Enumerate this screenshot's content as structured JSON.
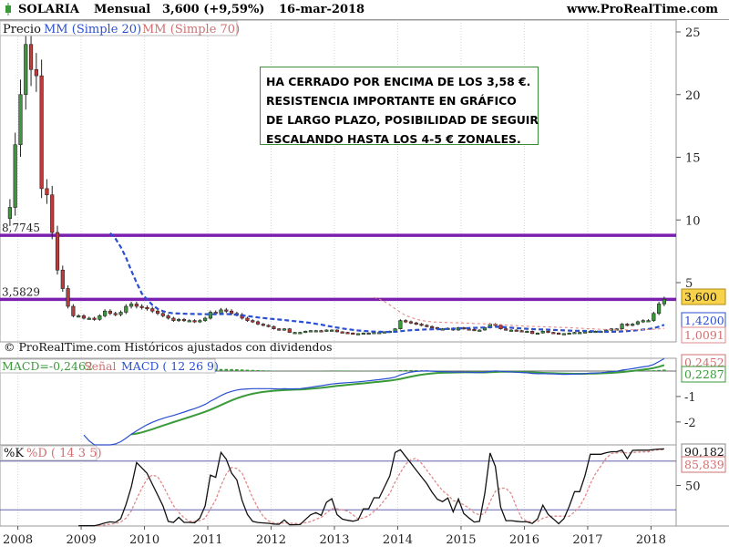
{
  "header": {
    "instrument": "SOLARIA",
    "period": "Mensual",
    "price_change": "3,600 (+9,59%)",
    "date": "16-mar-2018",
    "site": "www.ProRealTime.com"
  },
  "price_panel": {
    "legend": {
      "price": "Precio",
      "ma20": "MM (Simple 20)",
      "ma70": "MM (Simple 70)"
    },
    "credit": "© ProRealTime.com  Históricos ajustados con dividendos",
    "hline_labels": {
      "upper": "8,7745",
      "lower": "3,5829"
    },
    "badges": {
      "last": "3,600",
      "ma20": "1,4200",
      "ma70": "1,0091"
    },
    "note_lines": [
      "HA CERRADO POR ENCIMA DE LOS 3,58 €.",
      "RESISTENCIA IMPORTANTE EN GRÁFICO",
      "DE LARGO PLAZO, POSIBILIDAD DE SEGUIR",
      "ESCALANDO HASTA LOS 4-5 € ZONALES."
    ]
  },
  "macd_panel": {
    "legend": {
      "macd": "MACD=-0,2462",
      "signal": "Señal",
      "params": "MACD ( 12 26 9)"
    },
    "badges": {
      "top": "0,2452",
      "bottom": "0,2287"
    }
  },
  "stoch_panel": {
    "legend": {
      "k": "%K",
      "d": "%D ( 14 3 5)"
    },
    "badges": {
      "top": "90,182",
      "bottom": "85,839"
    }
  },
  "colors": {
    "up": "#3a9a3a",
    "down": "#c03a3a",
    "ma20": "#2a4fd0",
    "ma70": "#e08a8a",
    "hline": "#7a1fb0",
    "last_badge": "#f7d24a",
    "grid": "#d8d8d8"
  },
  "chart_data": [
    {
      "type": "candlestick",
      "title": "SOLARIA Mensual",
      "x": [
        "2007-11",
        "2007-12",
        "2008-01",
        "2008-02",
        "2008-03",
        "2008-04",
        "2008-05",
        "2008-06",
        "2008-07",
        "2008-08",
        "2008-09",
        "2008-10",
        "2008-11",
        "2008-12",
        "2009-01",
        "2009-02",
        "2009-03",
        "2009-04",
        "2009-05",
        "2009-06",
        "2009-07",
        "2009-08",
        "2009-09",
        "2009-10",
        "2009-11",
        "2009-12",
        "2010-01",
        "2010-02",
        "2010-03",
        "2010-04",
        "2010-05",
        "2010-06",
        "2010-07",
        "2010-08",
        "2010-09",
        "2010-10",
        "2010-11",
        "2010-12",
        "2011-01",
        "2011-02",
        "2011-03",
        "2011-04",
        "2011-05",
        "2011-06",
        "2011-07",
        "2011-08",
        "2011-09",
        "2011-10",
        "2011-11",
        "2011-12",
        "2012-01",
        "2012-02",
        "2012-03",
        "2012-04",
        "2012-05",
        "2012-06",
        "2012-07",
        "2012-08",
        "2012-09",
        "2012-10",
        "2012-11",
        "2012-12",
        "2013-01",
        "2013-02",
        "2013-03",
        "2013-04",
        "2013-05",
        "2013-06",
        "2013-07",
        "2013-08",
        "2013-09",
        "2013-10",
        "2013-11",
        "2013-12",
        "2014-01",
        "2014-02",
        "2014-03",
        "2014-04",
        "2014-05",
        "2014-06",
        "2014-07",
        "2014-08",
        "2014-09",
        "2014-10",
        "2014-11",
        "2014-12",
        "2015-01",
        "2015-02",
        "2015-03",
        "2015-04",
        "2015-05",
        "2015-06",
        "2015-07",
        "2015-08",
        "2015-09",
        "2015-10",
        "2015-11",
        "2015-12",
        "2016-01",
        "2016-02",
        "2016-03",
        "2016-04",
        "2016-05",
        "2016-06",
        "2016-07",
        "2016-08",
        "2016-09",
        "2016-10",
        "2016-11",
        "2016-12",
        "2017-01",
        "2017-02",
        "2017-03",
        "2017-04",
        "2017-05",
        "2017-06",
        "2017-07",
        "2017-08",
        "2017-09",
        "2017-10",
        "2017-11",
        "2017-12",
        "2018-01",
        "2018-02",
        "2018-03"
      ],
      "close": [
        11.0,
        16.0,
        20.0,
        24.0,
        22.0,
        21.5,
        12.5,
        12.0,
        9.0,
        6.0,
        4.5,
        3.0,
        2.2,
        2.2,
        2.0,
        2.0,
        1.9,
        2.2,
        2.6,
        2.4,
        2.3,
        2.5,
        3.0,
        3.2,
        3.0,
        2.9,
        2.8,
        2.6,
        2.4,
        2.2,
        2.0,
        1.8,
        1.9,
        1.8,
        1.8,
        1.7,
        1.8,
        2.0,
        2.5,
        2.4,
        2.7,
        2.6,
        2.4,
        2.3,
        2.0,
        1.8,
        1.7,
        1.5,
        1.4,
        1.3,
        1.1,
        1.0,
        1.1,
        0.8,
        0.8,
        0.8,
        0.9,
        0.95,
        0.95,
        0.9,
        1.0,
        1.0,
        0.85,
        0.8,
        0.75,
        0.7,
        0.7,
        0.75,
        0.75,
        0.8,
        0.8,
        0.85,
        0.9,
        1.1,
        1.8,
        1.7,
        1.6,
        1.5,
        1.4,
        1.3,
        1.2,
        1.1,
        1.1,
        1.15,
        1.0,
        1.2,
        1.1,
        1.05,
        1.0,
        1.0,
        1.2,
        1.5,
        1.4,
        1.1,
        1.0,
        1.0,
        0.95,
        0.9,
        0.9,
        0.7,
        0.75,
        0.9,
        0.8,
        0.75,
        0.65,
        0.7,
        0.75,
        0.8,
        0.8,
        0.85,
        0.9,
        0.9,
        0.9,
        1.0,
        1.1,
        1.1,
        1.5,
        1.4,
        1.5,
        1.7,
        1.8,
        1.8,
        2.4,
        3.2,
        3.6
      ],
      "ylim": [
        0,
        26
      ],
      "yticks": [
        5,
        10,
        15,
        20,
        25
      ],
      "xtick_labels": [
        "2008",
        "2009",
        "2010",
        "2011",
        "2012",
        "2013",
        "2014",
        "2015",
        "2016",
        "2017",
        "2018"
      ],
      "hlines": [
        8.7745,
        3.5829
      ]
    },
    {
      "type": "line",
      "name": "MACD ( 12 26 9)",
      "yticks": [
        -1,
        -2
      ],
      "ylim": [
        -2.9,
        0.5
      ]
    },
    {
      "type": "line",
      "name": "%D ( 14 3 5)",
      "yticks": [
        50
      ],
      "hlines": [
        20,
        80
      ],
      "ylim": [
        0,
        100
      ]
    }
  ]
}
